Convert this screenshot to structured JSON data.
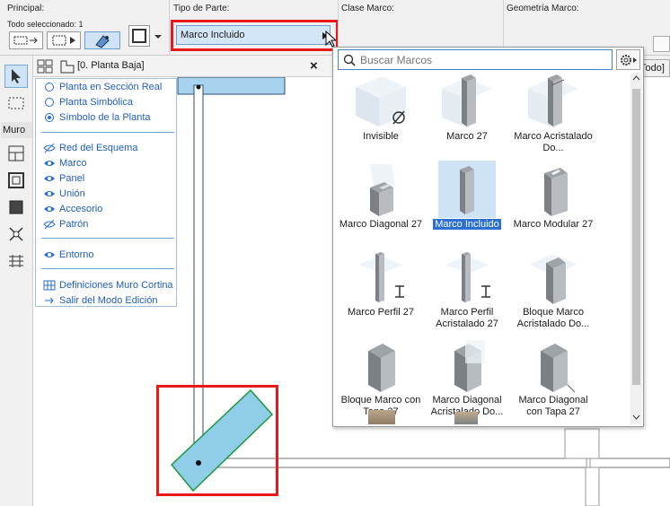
{
  "infobox": {
    "principal_label": "Principal:",
    "selected_text": "Todo seleccionado: 1",
    "tipo_label": "Tipo de Parte:",
    "tipo_value": "Marco Incluido",
    "clase_label": "Clase Marco:",
    "geometria_label": "Geometría Marco:"
  },
  "toolbox": {
    "muro_label": "Muro"
  },
  "tab": {
    "title": "[0. Planta Baja]",
    "close": "×"
  },
  "overlay_menu": {
    "view_options": [
      "Planta en Sección Real",
      "Planta Simbólica",
      "Símbolo de la Planta"
    ],
    "selected_view": "Símbolo de la Planta",
    "layers": [
      {
        "label": "Red del Esquema",
        "visible": false
      },
      {
        "label": "Marco",
        "visible": true
      },
      {
        "label": "Panel",
        "visible": true
      },
      {
        "label": "Unión",
        "visible": true
      },
      {
        "label": "Accesorio",
        "visible": true
      },
      {
        "label": "Patrón",
        "visible": false
      }
    ],
    "entorno": "Entorno",
    "definitions": "Definiciones Muro Cortina",
    "exit": "Salir del Modo Edición"
  },
  "dropdown": {
    "search_placeholder": "Buscar Marcos",
    "selected": "Marco Incluido",
    "items": [
      {
        "label": "Invisible",
        "icon": "empty-set-icon"
      },
      {
        "label": "Marco 27",
        "icon": "frame-icon"
      },
      {
        "label": "Marco Acristalado Do...",
        "icon": "glazed-frame-icon"
      },
      {
        "label": "Marco Diagonal 27",
        "icon": "diagonal-frame-icon"
      },
      {
        "label": "Marco Incluido",
        "icon": "inset-frame-icon"
      },
      {
        "label": "Marco Modular 27",
        "icon": "modular-frame-icon"
      },
      {
        "label": "Marco Perfil 27",
        "icon": "i-beam-icon"
      },
      {
        "label": "Marco Perfil Acristalado 27",
        "icon": "i-beam-icon"
      },
      {
        "label": "Bloque Marco Acristalado Do...",
        "icon": "block-frame-icon"
      },
      {
        "label": "Bloque Marco con Tapa 27",
        "icon": "capped-block-icon"
      },
      {
        "label": "Marco Diagonal Acristalado Do...",
        "icon": "diagonal-glazed-icon"
      },
      {
        "label": "Marco Diagonal con Tapa 27",
        "icon": "diagonal-capped-icon"
      }
    ]
  },
  "plan": {
    "right_partial_label": "Todo]"
  },
  "colors": {
    "accent": "#2b6fd3",
    "highlight_red": "#e8191b",
    "panel_fill": "#8fcde9",
    "panel_stroke": "#1b9a3a"
  }
}
